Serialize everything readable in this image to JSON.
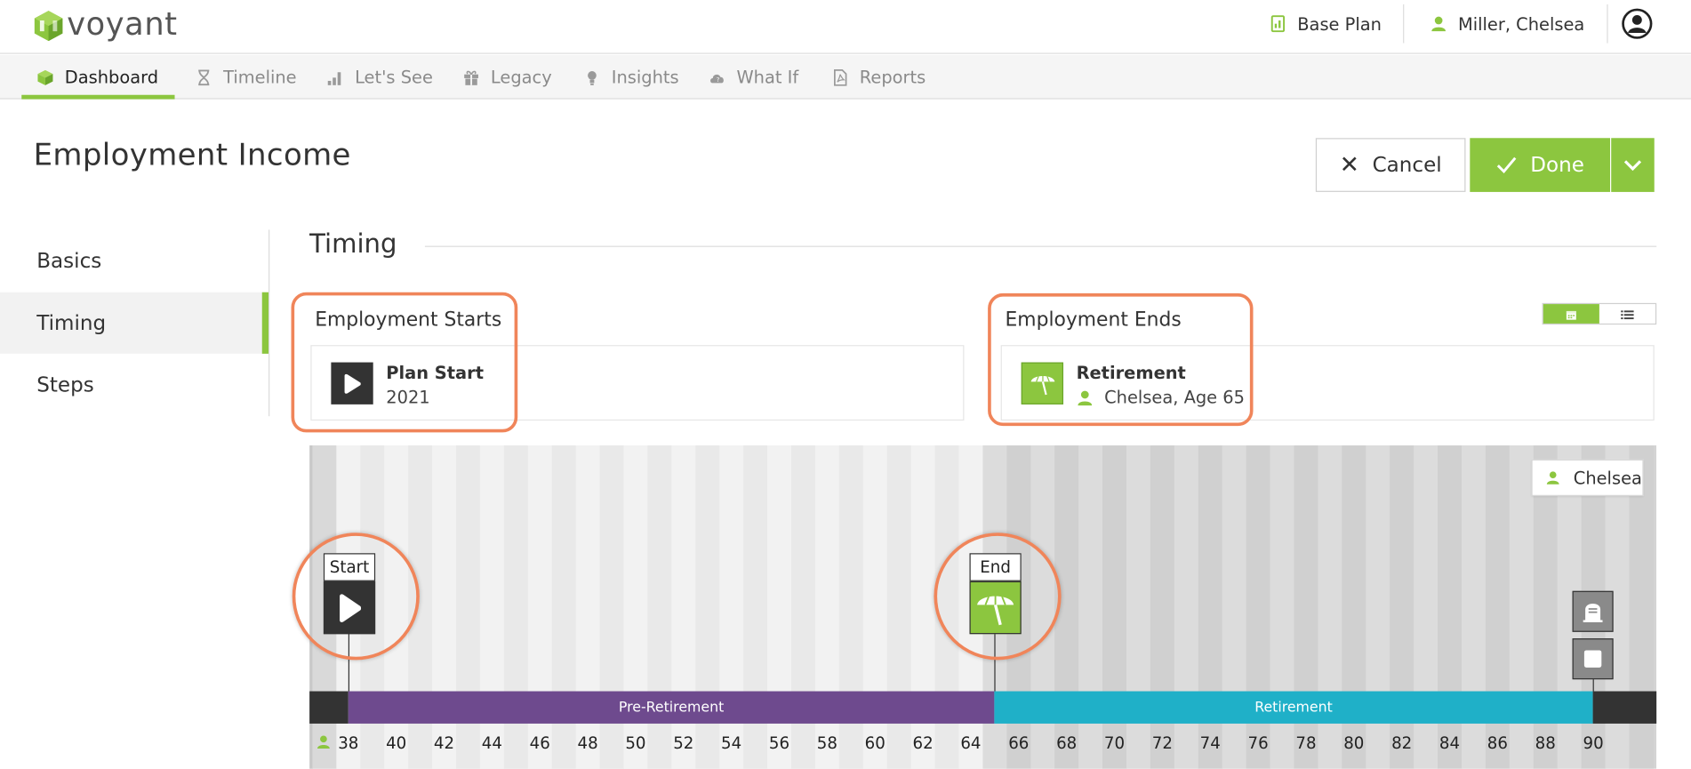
{
  "app": {
    "brand": "voyant",
    "accent": "#8cc63f"
  },
  "header": {
    "plan_label": "Base Plan",
    "user_name": "Miller, Chelsea"
  },
  "nav": {
    "tabs": [
      {
        "label": "Dashboard",
        "icon": "cube-icon"
      },
      {
        "label": "Timeline",
        "icon": "hourglass-icon"
      },
      {
        "label": "Let's See",
        "icon": "bar-chart-icon"
      },
      {
        "label": "Legacy",
        "icon": "gift-icon"
      },
      {
        "label": "Insights",
        "icon": "lightbulb-icon"
      },
      {
        "label": "What If",
        "icon": "cloud-question-icon"
      },
      {
        "label": "Reports",
        "icon": "pdf-icon"
      }
    ],
    "active": "Dashboard"
  },
  "page": {
    "title": "Employment Income",
    "cancel_label": "Cancel",
    "done_label": "Done"
  },
  "sidebar": {
    "items": [
      {
        "label": "Basics"
      },
      {
        "label": "Timing"
      },
      {
        "label": "Steps"
      }
    ],
    "active": "Timing"
  },
  "section": {
    "title": "Timing",
    "start": {
      "label": "Employment Starts",
      "event": "Plan Start",
      "detail": "2021"
    },
    "end": {
      "label": "Employment Ends",
      "event": "Retirement",
      "detail": "Chelsea, Age 65"
    }
  },
  "timeline": {
    "person": "Chelsea",
    "start_marker": "Start",
    "end_marker": "End",
    "phases": [
      {
        "label": "Pre-Retirement",
        "color": "#6e4a8e"
      },
      {
        "label": "Retirement",
        "color": "#1fb0c8"
      }
    ],
    "ages": [
      "38",
      "40",
      "42",
      "44",
      "46",
      "48",
      "50",
      "52",
      "54",
      "56",
      "58",
      "60",
      "62",
      "64",
      "66",
      "68",
      "70",
      "72",
      "74",
      "76",
      "78",
      "80",
      "82",
      "84",
      "86",
      "88",
      "90"
    ]
  }
}
